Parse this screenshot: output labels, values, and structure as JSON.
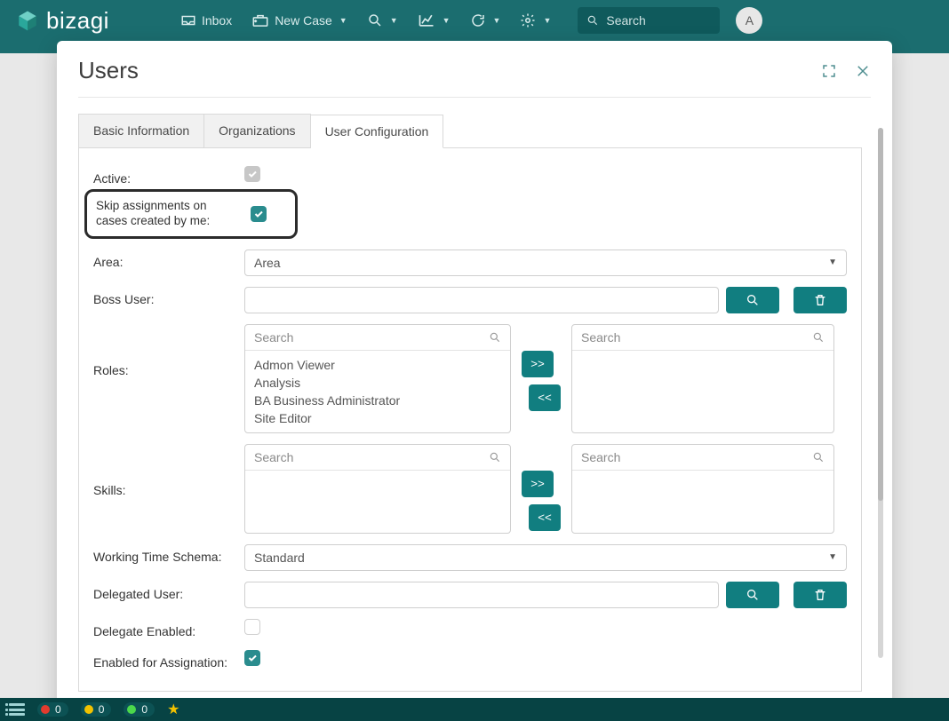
{
  "header": {
    "brand": "bizagi",
    "inbox": "Inbox",
    "new_case": "New Case",
    "search_placeholder": "Search",
    "avatar_initial": "A"
  },
  "dialog": {
    "title": "Users"
  },
  "tabs": {
    "basic": "Basic Information",
    "orgs": "Organizations",
    "config": "User Configuration"
  },
  "form": {
    "active_label": "Active:",
    "skip_label": "Skip assignments on cases created by me:",
    "area_label": "Area:",
    "area_value": "Area",
    "boss_label": "Boss User:",
    "roles_label": "Roles:",
    "skills_label": "Skills:",
    "wts_label": "Working Time Schema:",
    "wts_value": "Standard",
    "delegated_label": "Delegated User:",
    "delegate_enabled_label": "Delegate Enabled:",
    "enabled_assign_label": "Enabled for Assignation:",
    "list_search_placeholder": "Search",
    "move_right": ">>",
    "move_left": "<<",
    "roles_available": [
      "Admon Viewer",
      "Analysis",
      "BA Business Administrator",
      "Site Editor"
    ]
  },
  "status": {
    "red_count": "0",
    "yellow_count": "0",
    "green_count": "0"
  }
}
